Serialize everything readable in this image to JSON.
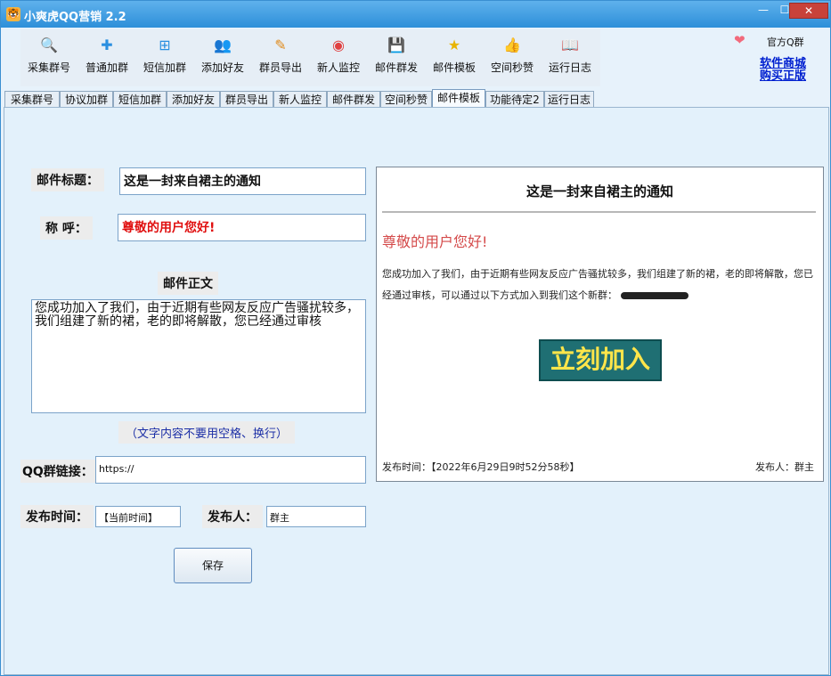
{
  "window": {
    "title": "小爽虎QQ营销 2.2",
    "min": "—",
    "max": "☐",
    "close": "✕"
  },
  "toolbar": [
    {
      "label": "采集群号",
      "icon": "search-icon",
      "glyph": "🔍",
      "color": "#2a6fd6"
    },
    {
      "label": "普通加群",
      "icon": "plus-icon",
      "glyph": "✚",
      "color": "#2a8fe0"
    },
    {
      "label": "短信加群",
      "icon": "plus-box-icon",
      "glyph": "⊞",
      "color": "#2a8fe0"
    },
    {
      "label": "添加好友",
      "icon": "users-icon",
      "glyph": "👥",
      "color": "#3aa66a"
    },
    {
      "label": "群员导出",
      "icon": "pencil-icon",
      "glyph": "✎",
      "color": "#e08a1a"
    },
    {
      "label": "新人监控",
      "icon": "record-icon",
      "glyph": "◉",
      "color": "#e04040"
    },
    {
      "label": "邮件群发",
      "icon": "save-icon",
      "glyph": "💾",
      "color": "#2a6fd6"
    },
    {
      "label": "邮件模板",
      "icon": "star-icon",
      "glyph": "★",
      "color": "#e8b400"
    },
    {
      "label": "空间秒赞",
      "icon": "thumb-up-icon",
      "glyph": "👍",
      "color": "#e8a53a"
    },
    {
      "label": "运行日志",
      "icon": "book-icon",
      "glyph": "📖",
      "color": "#e8a53a"
    }
  ],
  "header_right": {
    "qq_group": "官方Q群",
    "shop_line1": "软件商城",
    "shop_line2": "购买正版",
    "heart_icon": "heart-icon"
  },
  "tabs": [
    "采集群号",
    "协议加群",
    "短信加群",
    "添加好友",
    "群员导出",
    "新人监控",
    "邮件群发",
    "空间秒赞",
    "邮件模板",
    "功能待定2",
    "运行日志"
  ],
  "active_tab": "邮件模板",
  "form": {
    "subject_label": "邮件标题：",
    "subject_value": "这是一封来自裙主的通知",
    "greeting_label": "称  呼：",
    "greeting_value": "尊敬的用户您好!",
    "body_label": "邮件正文",
    "body_value": "您成功加入了我们，由于近期有些网友反应广告骚扰较多，我们组建了新的裙，老的即将解散，您已经通过审核",
    "body_hint": "（文字内容不要用空格、换行）",
    "qq_link_label": "QQ群链接：",
    "qq_link_value": "https://",
    "time_label": "发布时间：",
    "time_value": "【当前时间】",
    "publisher_label": "发布人：",
    "publisher_value": "群主",
    "save_label": "保存"
  },
  "preview": {
    "title": "这是一封来自裙主的通知",
    "greeting": "尊敬的用户您好!",
    "body": "您成功加入了我们，由于近期有些网友反应广告骚扰较多，我们组建了新的裙，老的即将解散，您已经通过审核，可以通过以下方式加入到我们这个新群：",
    "join_button": "立刻加入",
    "time": "发布时间：【2022年6月29日9时52分58秒】",
    "publisher": "发布人：群主"
  }
}
